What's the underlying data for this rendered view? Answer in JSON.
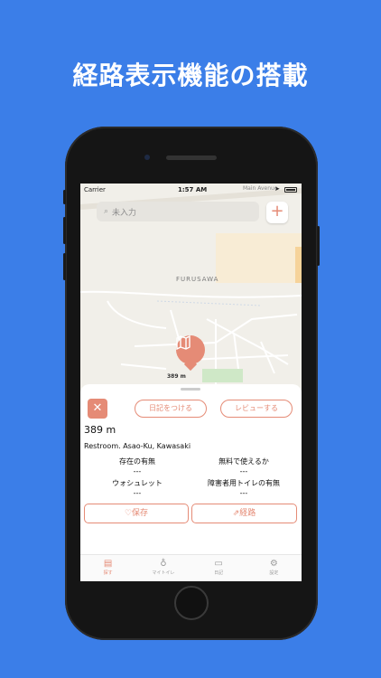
{
  "headline": "経路表示機能の搭載",
  "status_bar": {
    "carrier": "Carrier",
    "time": "1:57 AM"
  },
  "map": {
    "street": "Main Avenue",
    "district": "FURUSAWA",
    "pin_distance": "389 m"
  },
  "search": {
    "placeholder": "未入力",
    "add_label": "+"
  },
  "sheet": {
    "close_label": "✕",
    "diary_label": "日記をつける",
    "review_label": "レビューする",
    "distance": "389 m",
    "place": "Restroom. Asao-Ku, Kawasaki",
    "attributes": [
      {
        "label": "存在の有無",
        "value": "---"
      },
      {
        "label": "無料で使えるか",
        "value": "---"
      },
      {
        "label": "ウォシュレット",
        "value": "---"
      },
      {
        "label": "障害者用トイレの有無",
        "value": "---"
      }
    ],
    "save_label": "♡保存",
    "route_label": "⇗経路"
  },
  "tabs": [
    {
      "label": "探す",
      "icon": "map-icon",
      "active": true
    },
    {
      "label": "マイトイレ",
      "icon": "toilet-icon",
      "active": false
    },
    {
      "label": "日記",
      "icon": "diary-icon",
      "active": false
    },
    {
      "label": "設定",
      "icon": "gear-icon",
      "active": false
    }
  ],
  "colors": {
    "background": "#3b7ee8",
    "accent": "#e58b76"
  }
}
